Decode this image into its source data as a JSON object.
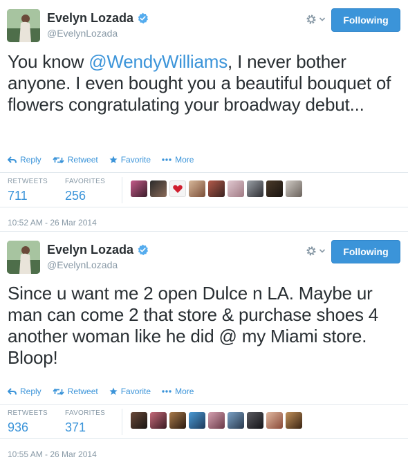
{
  "tweets": [
    {
      "name": "Evelyn Lozada",
      "handle": "@EvelynLozada",
      "follow_label": "Following",
      "text_before": "You know ",
      "mention": "@WendyWilliams",
      "text_after": ", I never bother anyone. I even bought you a beautiful bouquet of flowers congratulating your broadway debut...",
      "actions": {
        "reply": "Reply",
        "retweet": "Retweet",
        "favorite": "Favorite",
        "more": "More"
      },
      "stats": {
        "retweets_label": "RETWEETS",
        "retweets": "711",
        "favorites_label": "FAVORITES",
        "favorites": "256"
      },
      "timestamp": "10:52 AM - 26 Mar 2014"
    },
    {
      "name": "Evelyn Lozada",
      "handle": "@EvelynLozada",
      "follow_label": "Following",
      "text_before": "Since u want me 2 open Dulce n LA. Maybe ur man can come 2 that store & purchase shoes 4 another woman like he did @ my Miami store. Bloop!",
      "mention": "",
      "text_after": "",
      "actions": {
        "reply": "Reply",
        "retweet": "Retweet",
        "favorite": "Favorite",
        "more": "More"
      },
      "stats": {
        "retweets_label": "RETWEETS",
        "retweets": "936",
        "favorites_label": "FAVORITES",
        "favorites": "371"
      },
      "timestamp": "10:55 AM - 26 Mar 2014"
    }
  ],
  "colors": {
    "link": "#3b94d9",
    "follow_button": "#3b94d9",
    "muted": "#8899a6",
    "text": "#292f33"
  },
  "icons": [
    "verified-badge-icon",
    "gear-icon",
    "chevron-down-icon",
    "reply-icon",
    "retweet-icon",
    "star-icon",
    "more-dots-icon"
  ]
}
